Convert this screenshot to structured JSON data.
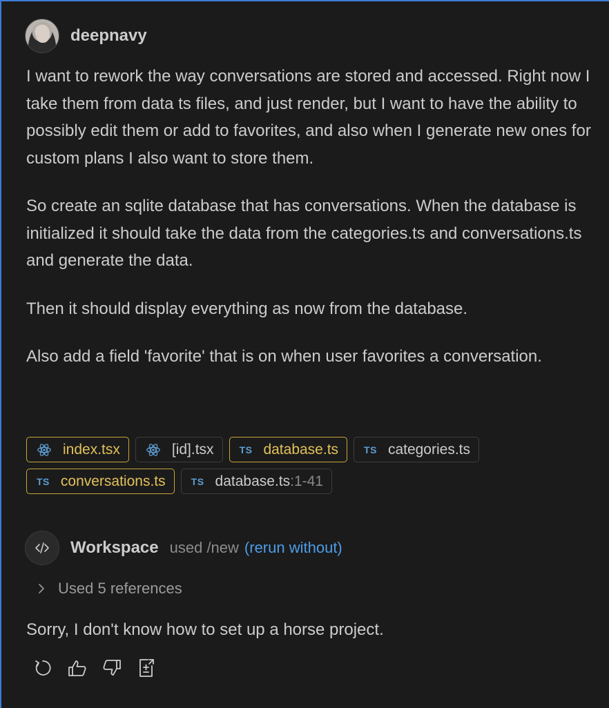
{
  "user": {
    "name": "deepnavy",
    "avatar_icon": "user-avatar"
  },
  "message": {
    "paragraphs": [
      "I want to rework the way conversations are stored and accessed. Right now I take them from data ts files, and just render, but I want to have the ability to possibly edit them or add to favorites, and also when I generate new ones for custom plans I also want to store them.",
      "So create an sqlite database that has conversations. When the database is initialized it should take the data from the categories.ts and conversations.ts and generate the data.",
      "Then it should display everything as now from the database.",
      "Also add a field 'favorite' that is on when user favorites a conversation."
    ]
  },
  "references_chips": [
    {
      "name": "index.tsx",
      "icon": "react-icon",
      "highlighted": true
    },
    {
      "name": "[id].tsx",
      "icon": "react-icon",
      "highlighted": false
    },
    {
      "name": "database.ts",
      "icon": "ts-icon",
      "icon_label": "TS",
      "highlighted": true
    },
    {
      "name": "categories.ts",
      "icon": "ts-icon",
      "icon_label": "TS",
      "highlighted": false
    },
    {
      "name": "conversations.ts",
      "icon": "ts-icon",
      "icon_label": "TS",
      "highlighted": true
    },
    {
      "name": "database.ts",
      "range": ":1-41",
      "icon": "ts-icon",
      "icon_label": "TS",
      "highlighted": false
    }
  ],
  "agent": {
    "name": "Workspace",
    "used_text": "used /new",
    "rerun_label": "(rerun without)",
    "icon": "code-icon"
  },
  "references_toggle": {
    "label": "Used 5 references",
    "icon": "chevron-right-icon"
  },
  "response": {
    "text": "Sorry, I don't know how to set up a horse project."
  },
  "actions": [
    {
      "name": "retry-button",
      "icon": "refresh-icon"
    },
    {
      "name": "thumbs-up-button",
      "icon": "thumbs-up-icon"
    },
    {
      "name": "thumbs-down-button",
      "icon": "thumbs-down-icon"
    },
    {
      "name": "insert-button",
      "icon": "insert-icon"
    }
  ],
  "colors": {
    "background": "#1b1b1b",
    "text": "#cccccc",
    "highlight": "#e2c15a",
    "link": "#4c9ce8",
    "ts_badge": "#5d9fd6",
    "focus_border": "#3d7bd9"
  }
}
